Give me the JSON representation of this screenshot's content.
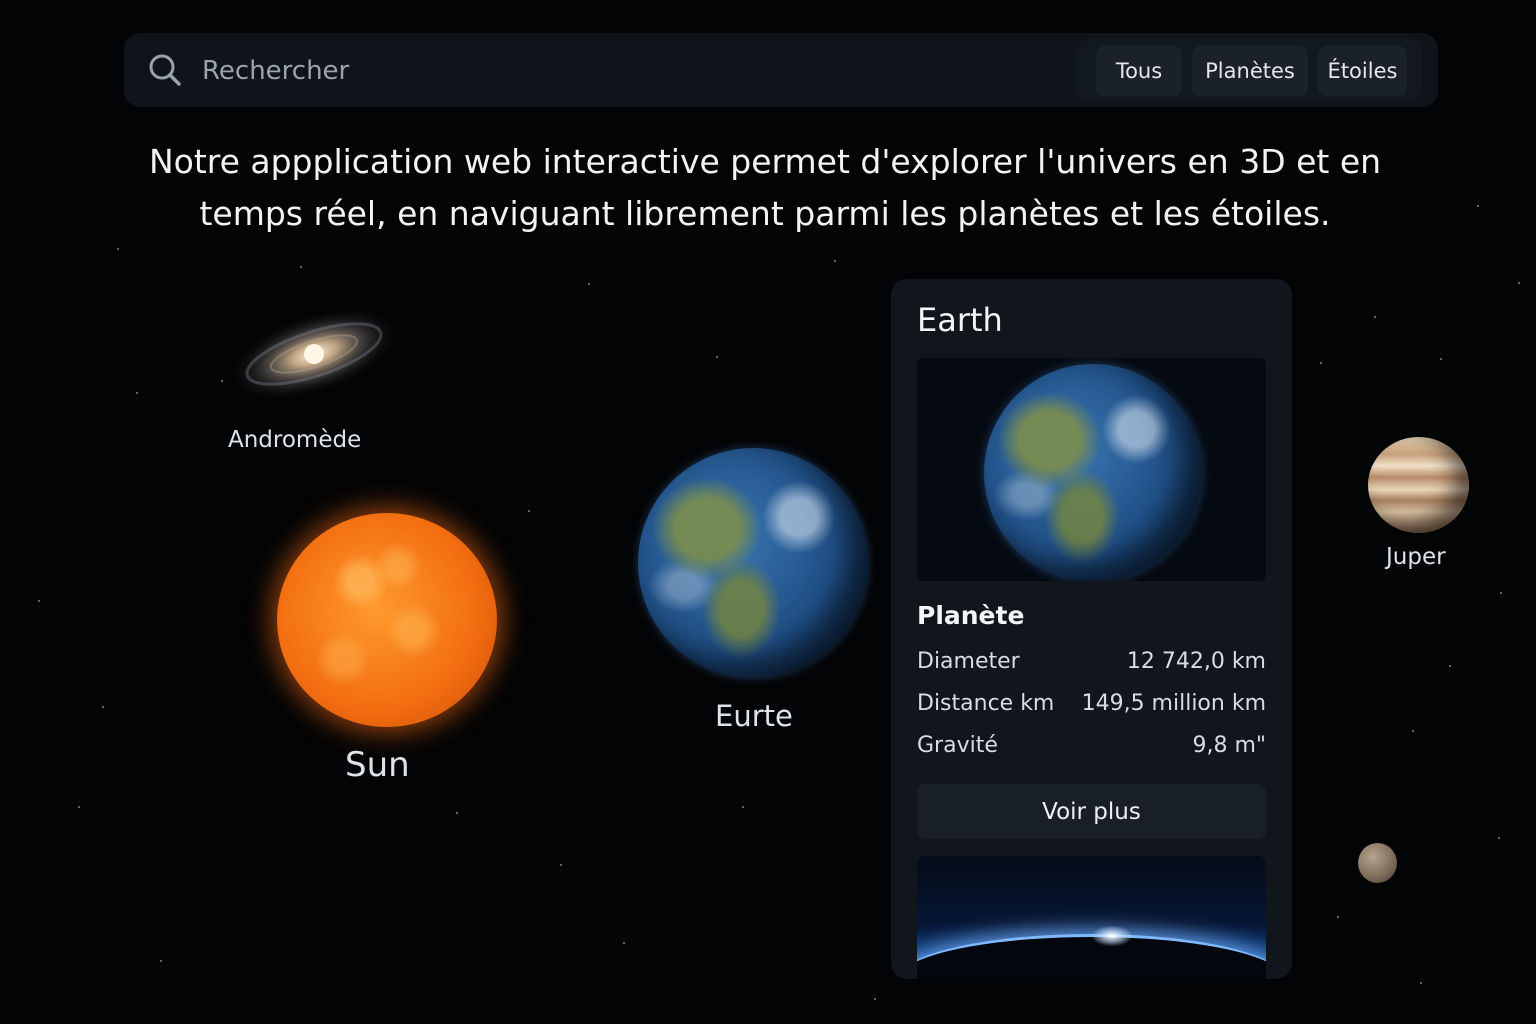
{
  "search": {
    "placeholder": "Rechercher",
    "filters": [
      {
        "label": "Tous"
      },
      {
        "label": "Planètes"
      },
      {
        "label": "Étoiles"
      }
    ]
  },
  "intro": {
    "line1": "Notre appplication web interactive permet d'explorer l'univers en 3D et en",
    "line2": "temps réel, en naviguant librement parmi les planètes et les étoiles."
  },
  "bodies": {
    "andromeda": {
      "label": "Andromède"
    },
    "sun": {
      "label": "Sun"
    },
    "earth": {
      "label": "Eurte"
    },
    "jupiter": {
      "label": "Juper"
    }
  },
  "card": {
    "title": "Earth",
    "type": "Planète",
    "stats": [
      {
        "label": "Diameter",
        "value": "12 742,0 km"
      },
      {
        "label": "Distance km",
        "value": "149,5 million km"
      },
      {
        "label": "Gravité",
        "value": "9,8 m\""
      }
    ],
    "more_label": "Voir plus"
  },
  "icons": {
    "search": "search-icon"
  },
  "colors": {
    "background": "#030405",
    "panel": "#0f141b",
    "card": "#11161d",
    "sun": "#f26d10"
  }
}
